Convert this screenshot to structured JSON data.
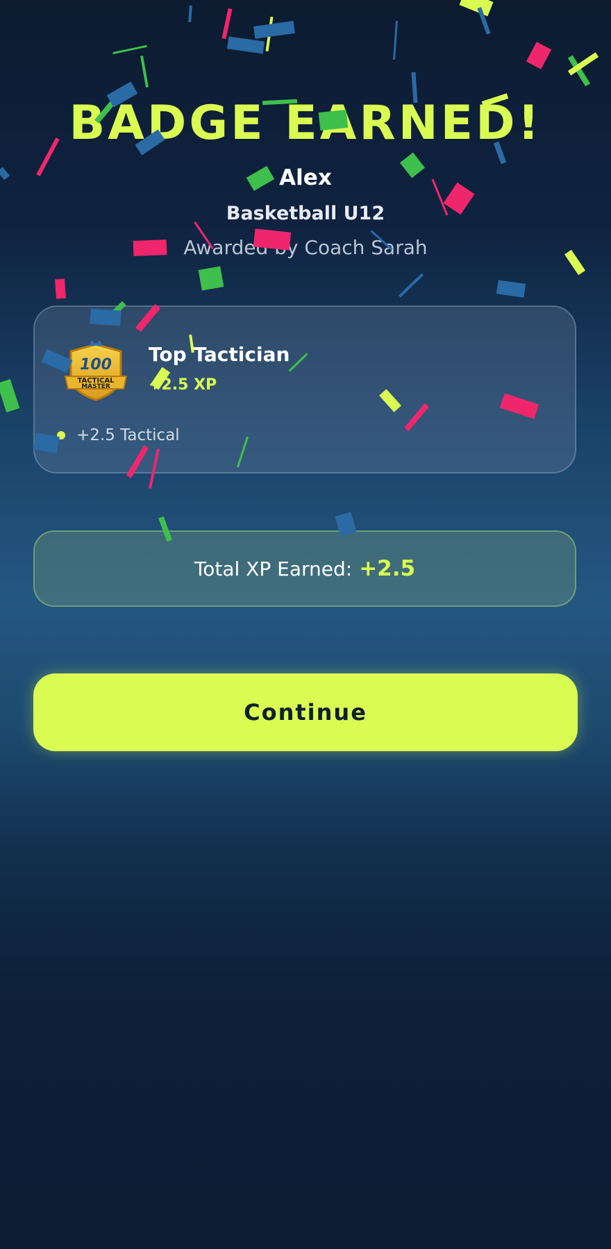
{
  "screen": {
    "title": "BADGE EARNED!",
    "athlete_name": "Alex",
    "team": "Basketball U12",
    "awarded_by": "Awarded by Coach Sarah"
  },
  "badge": {
    "emblem_number": "100",
    "emblem_text_line1": "TACTICAL",
    "emblem_text_line2": "MASTER",
    "name": "Top Tactician",
    "xp": "+2.5 XP",
    "stats": [
      {
        "label": "+2.5 Tactical"
      }
    ]
  },
  "total": {
    "label": "Total XP Earned:",
    "value": "+2.5"
  },
  "actions": {
    "continue_label": "Continue"
  },
  "colors": {
    "accent": "#dafb52",
    "confetti_pink": "#f0266c",
    "confetti_green": "#3fbf4c",
    "confetti_blue": "#2a6aa5",
    "background_dark": "#0c1b30",
    "background_mid": "#245781"
  },
  "icons": {
    "badge_emblem": "tactical-master-badge-icon",
    "stat_bullet": "bullet-dot-icon"
  }
}
